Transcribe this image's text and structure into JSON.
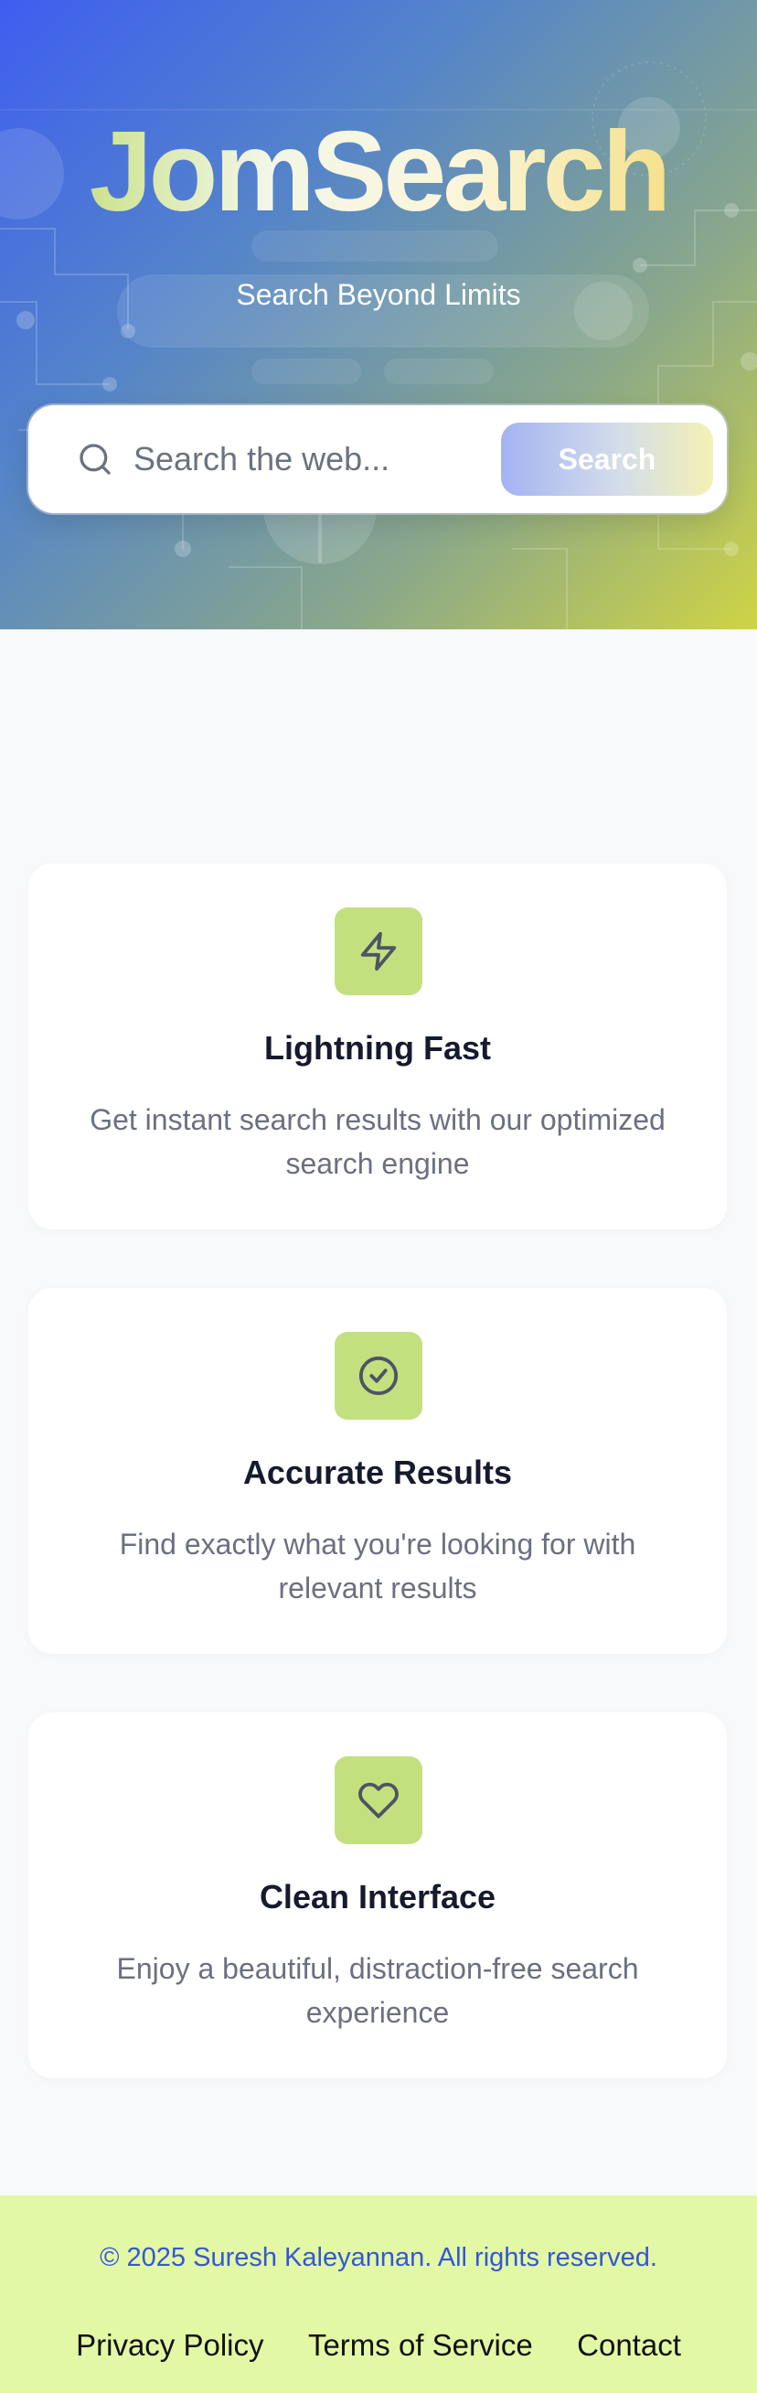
{
  "hero": {
    "brand": "JomSearch",
    "tagline": "Search Beyond Limits"
  },
  "search": {
    "placeholder": "Search the web...",
    "button_label": "Search"
  },
  "features": [
    {
      "icon": "lightning-icon",
      "title": "Lightning Fast",
      "description": "Get instant search results with our optimized search engine"
    },
    {
      "icon": "check-circle-icon",
      "title": "Accurate Results",
      "description": "Find exactly what you're looking for with relevant results"
    },
    {
      "icon": "heart-icon",
      "title": "Clean Interface",
      "description": "Enjoy a beautiful, distraction-free search experience"
    }
  ],
  "footer": {
    "copyright": "© 2025 Suresh Kaleyannan. All rights reserved.",
    "links": [
      "Privacy Policy",
      "Terms of Service",
      "Contact"
    ]
  },
  "colors": {
    "hero_gradient_start": "#3e5ef0",
    "hero_gradient_end": "#cfd444",
    "feature_icon_bg": "#c3e07f",
    "footer_bg": "#e2f8a4",
    "copyright_text": "#3556d8"
  }
}
